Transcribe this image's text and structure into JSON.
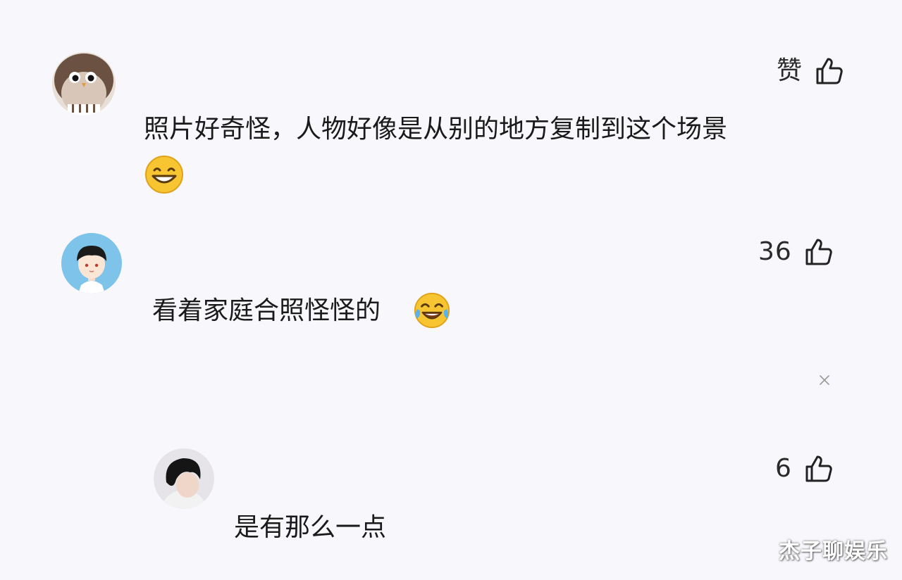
{
  "comments": [
    {
      "avatar": "penguin-avatar",
      "like_label": "赞",
      "text": "照片好奇怪，人物好像是从别的地方复制到这个场景",
      "emoji": "grinning-emoji"
    },
    {
      "avatar": "cartoon-boy-avatar",
      "like_label": "36",
      "text": "看着家庭合照怪怪的",
      "emoji": "tears-of-joy-emoji"
    },
    {
      "avatar": "dark-hair-avatar",
      "like_label": "6",
      "text": "是有那么一点"
    }
  ],
  "watermark": "杰子聊娱乐",
  "colors": {
    "background": "#f8f8fc",
    "text": "#1a1a1a",
    "emoji_yellow": "#f7c531",
    "avatar_blue": "#7ec3ea"
  }
}
